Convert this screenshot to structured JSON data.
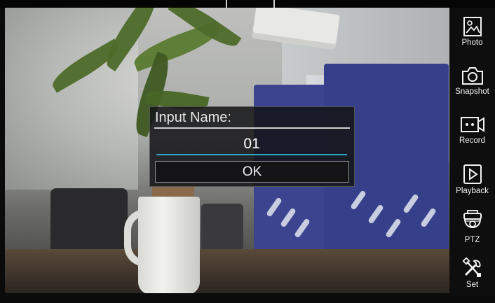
{
  "dialog": {
    "title": "Input Name:",
    "input_value": "01",
    "ok_label": "OK"
  },
  "toolbar": {
    "items": [
      {
        "label": "Photo",
        "icon": "photo-icon"
      },
      {
        "label": "Snapshot",
        "icon": "camera-icon"
      },
      {
        "label": "Record",
        "icon": "video-record-icon"
      },
      {
        "label": "Playback",
        "icon": "play-icon"
      },
      {
        "label": "PTZ",
        "icon": "ptz-camera-icon"
      },
      {
        "label": "Set",
        "icon": "tools-icon"
      }
    ]
  },
  "colors": {
    "input_underline": "#2aa6c6",
    "sidebar_bg": "#0e0e0e",
    "dialog_bg": "#141416"
  }
}
